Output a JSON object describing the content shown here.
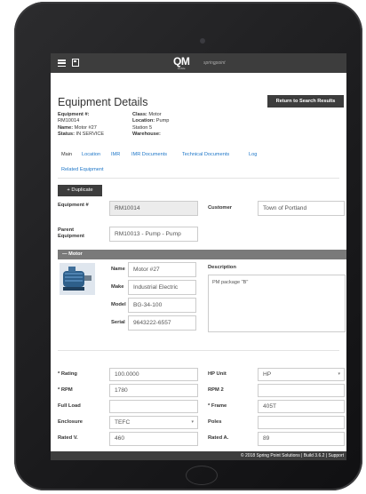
{
  "app": {
    "logo": "QM",
    "logo_sub": "mobile",
    "brand": "springpoint"
  },
  "page": {
    "title": "Equipment Details",
    "return_label": "Return to Search Results"
  },
  "summary": {
    "equipment_label": "Equipment #:",
    "equipment_value": "RM10014",
    "name_label": "Name:",
    "name_value": "Motor #27",
    "status_label": "Status:",
    "status_value": "IN SERVICE",
    "class_label": "Class:",
    "class_value": "Motor",
    "location_label": "Location:",
    "location_value": "Pump",
    "location_extra": "Station 5",
    "warehouse_label": "Warehouse:"
  },
  "tabs": [
    "Main",
    "Location",
    "IMR",
    "IMR Documents",
    "Technical Documents",
    "Log",
    "Related Equipment"
  ],
  "actions": {
    "duplicate_label": "+ Duplicate"
  },
  "header_fields": {
    "equipment_label": "Equipment #",
    "equipment_value": "RM10014",
    "customer_label": "Customer",
    "customer_value": "Town of Portland",
    "parent_label": "Parent Equipment",
    "parent_value": "RM10013 - Pump - Pump"
  },
  "motor_section": {
    "title": "Motor",
    "name_label": "Name",
    "name_value": "Motor #27",
    "make_label": "Make",
    "make_value": "Industrial Electric",
    "model_label": "Model",
    "model_value": "BG-34-100",
    "serial_label": "Serial",
    "serial_value": "9643222-6557",
    "description_label": "Description",
    "description_value": "PM package \"B\""
  },
  "specs": {
    "rating_label": "* Rating",
    "rating_value": "100.0000",
    "rpm_label": "* RPM",
    "rpm_value": "1780",
    "full_load_label": "Full Load",
    "enclosure_label": "Enclosure",
    "enclosure_value": "TEFC",
    "rated_v_label": "Rated V.",
    "rated_v_value": "460",
    "hp_unit_label": "HP Unit",
    "hp_unit_value": "HP",
    "rpm2_label": "RPM 2",
    "frame_label": "* Frame",
    "frame_value": "405T",
    "poles_label": "Poles",
    "rated_a_label": "Rated A.",
    "rated_a_value": "89"
  },
  "footer": {
    "text": "© 2018 Spring Point Solutions | Build 3.6.2 | Support"
  },
  "colors": {
    "bar": "#3d3d3d",
    "link": "#1f77c8",
    "section": "#7a7a7a"
  }
}
